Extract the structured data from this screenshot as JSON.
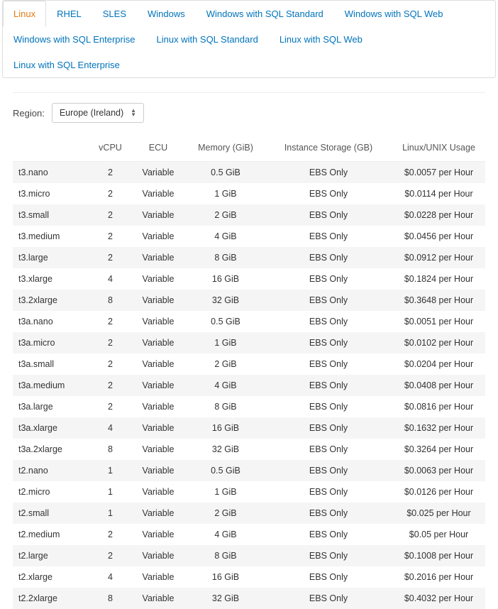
{
  "tabs": [
    {
      "label": "Linux",
      "active": true
    },
    {
      "label": "RHEL",
      "active": false
    },
    {
      "label": "SLES",
      "active": false
    },
    {
      "label": "Windows",
      "active": false
    },
    {
      "label": "Windows with SQL Standard",
      "active": false
    },
    {
      "label": "Windows with SQL Web",
      "active": false
    },
    {
      "label": "Windows with SQL Enterprise",
      "active": false
    },
    {
      "label": "Linux with SQL Standard",
      "active": false
    },
    {
      "label": "Linux with SQL Web",
      "active": false
    },
    {
      "label": "Linux with SQL Enterprise",
      "active": false
    }
  ],
  "region": {
    "label": "Region:",
    "selected": "Europe (Ireland)"
  },
  "table": {
    "headers": [
      "",
      "vCPU",
      "ECU",
      "Memory (GiB)",
      "Instance Storage (GB)",
      "Linux/UNIX Usage"
    ],
    "rows": [
      {
        "name": "t3.nano",
        "vcpu": "2",
        "ecu": "Variable",
        "memory": "0.5 GiB",
        "storage": "EBS Only",
        "price": "$0.0057 per Hour"
      },
      {
        "name": "t3.micro",
        "vcpu": "2",
        "ecu": "Variable",
        "memory": "1 GiB",
        "storage": "EBS Only",
        "price": "$0.0114 per Hour"
      },
      {
        "name": "t3.small",
        "vcpu": "2",
        "ecu": "Variable",
        "memory": "2 GiB",
        "storage": "EBS Only",
        "price": "$0.0228 per Hour"
      },
      {
        "name": "t3.medium",
        "vcpu": "2",
        "ecu": "Variable",
        "memory": "4 GiB",
        "storage": "EBS Only",
        "price": "$0.0456 per Hour"
      },
      {
        "name": "t3.large",
        "vcpu": "2",
        "ecu": "Variable",
        "memory": "8 GiB",
        "storage": "EBS Only",
        "price": "$0.0912 per Hour"
      },
      {
        "name": "t3.xlarge",
        "vcpu": "4",
        "ecu": "Variable",
        "memory": "16 GiB",
        "storage": "EBS Only",
        "price": "$0.1824 per Hour"
      },
      {
        "name": "t3.2xlarge",
        "vcpu": "8",
        "ecu": "Variable",
        "memory": "32 GiB",
        "storage": "EBS Only",
        "price": "$0.3648 per Hour"
      },
      {
        "name": "t3a.nano",
        "vcpu": "2",
        "ecu": "Variable",
        "memory": "0.5 GiB",
        "storage": "EBS Only",
        "price": "$0.0051 per Hour"
      },
      {
        "name": "t3a.micro",
        "vcpu": "2",
        "ecu": "Variable",
        "memory": "1 GiB",
        "storage": "EBS Only",
        "price": "$0.0102 per Hour"
      },
      {
        "name": "t3a.small",
        "vcpu": "2",
        "ecu": "Variable",
        "memory": "2 GiB",
        "storage": "EBS Only",
        "price": "$0.0204 per Hour"
      },
      {
        "name": "t3a.medium",
        "vcpu": "2",
        "ecu": "Variable",
        "memory": "4 GiB",
        "storage": "EBS Only",
        "price": "$0.0408 per Hour"
      },
      {
        "name": "t3a.large",
        "vcpu": "2",
        "ecu": "Variable",
        "memory": "8 GiB",
        "storage": "EBS Only",
        "price": "$0.0816 per Hour"
      },
      {
        "name": "t3a.xlarge",
        "vcpu": "4",
        "ecu": "Variable",
        "memory": "16 GiB",
        "storage": "EBS Only",
        "price": "$0.1632 per Hour"
      },
      {
        "name": "t3a.2xlarge",
        "vcpu": "8",
        "ecu": "Variable",
        "memory": "32 GiB",
        "storage": "EBS Only",
        "price": "$0.3264 per Hour"
      },
      {
        "name": "t2.nano",
        "vcpu": "1",
        "ecu": "Variable",
        "memory": "0.5 GiB",
        "storage": "EBS Only",
        "price": "$0.0063 per Hour"
      },
      {
        "name": "t2.micro",
        "vcpu": "1",
        "ecu": "Variable",
        "memory": "1 GiB",
        "storage": "EBS Only",
        "price": "$0.0126 per Hour"
      },
      {
        "name": "t2.small",
        "vcpu": "1",
        "ecu": "Variable",
        "memory": "2 GiB",
        "storage": "EBS Only",
        "price": "$0.025 per Hour"
      },
      {
        "name": "t2.medium",
        "vcpu": "2",
        "ecu": "Variable",
        "memory": "4 GiB",
        "storage": "EBS Only",
        "price": "$0.05 per Hour"
      },
      {
        "name": "t2.large",
        "vcpu": "2",
        "ecu": "Variable",
        "memory": "8 GiB",
        "storage": "EBS Only",
        "price": "$0.1008 per Hour"
      },
      {
        "name": "t2.xlarge",
        "vcpu": "4",
        "ecu": "Variable",
        "memory": "16 GiB",
        "storage": "EBS Only",
        "price": "$0.2016 per Hour"
      },
      {
        "name": "t2.2xlarge",
        "vcpu": "8",
        "ecu": "Variable",
        "memory": "32 GiB",
        "storage": "EBS Only",
        "price": "$0.4032 per Hour"
      }
    ]
  }
}
